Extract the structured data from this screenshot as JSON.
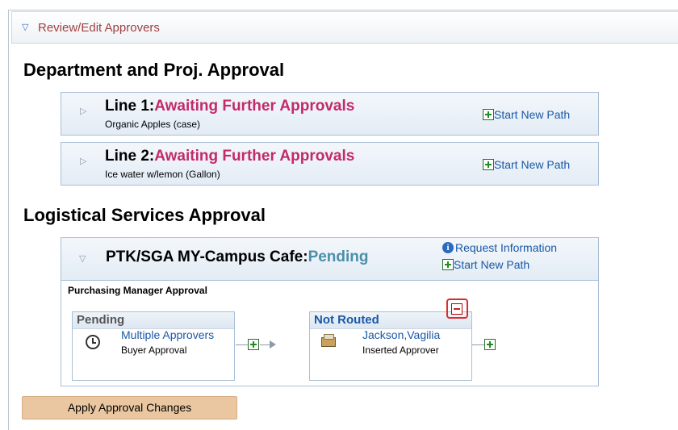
{
  "review_bar": {
    "label": "Review/Edit Approvers"
  },
  "sections": {
    "dept": "Department and Proj. Approval",
    "logistics": "Logistical Services Approval"
  },
  "lines": [
    {
      "title": "Line 1:",
      "status": "Awaiting Further Approvals",
      "item": "Organic Apples (case)",
      "action": "Start New Path"
    },
    {
      "title": "Line 2:",
      "status": "Awaiting Further Approvals",
      "item": "Ice water w/lemon (Gallon)",
      "action": "Start New Path"
    }
  ],
  "cafe": {
    "title": "PTK/SGA MY-Campus Cafe:",
    "status": "Pending",
    "request_info": "Request Information",
    "start_new_path": "Start New Path",
    "stage_label": "Purchasing Manager Approval",
    "steps": [
      {
        "status": "Pending",
        "name": "Multiple Approvers",
        "role": "Buyer Approval",
        "icon": "clock-icon"
      },
      {
        "status": "Not Routed",
        "name": "Jackson,Vagilia",
        "role": "Inserted Approver",
        "icon": "inbox-tray-icon"
      }
    ]
  },
  "apply_button": "Apply Approval Changes",
  "colors": {
    "status_awaiting": "#c32a6a",
    "status_pending": "#4c8fa8",
    "link": "#1a58a8",
    "apply_bg": "#eac7a0"
  }
}
